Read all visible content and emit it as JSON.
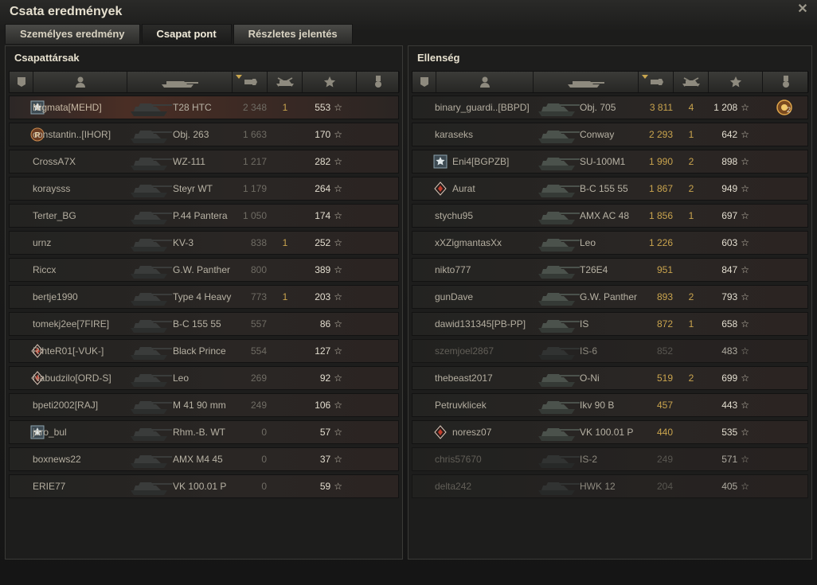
{
  "window": {
    "title": "Csata eredmények"
  },
  "tabs": [
    "Személyes eredmény",
    "Csapat pont",
    "Részletes jelentés"
  ],
  "active_tab": 1,
  "header_icons": [
    "platoon-icon",
    "player-icon",
    "tank-icon",
    "damage-icon",
    "kills-icon",
    "xp-star-icon",
    "medal-icon"
  ],
  "allies": {
    "title": "Csapattársak",
    "rows": [
      {
        "player": "Nigmata[MEHD]",
        "tank": "T28 HTC",
        "damage": "2 348",
        "kills": "1",
        "xp": "553",
        "badge": "star",
        "highlight": true
      },
      {
        "player": "constantin..[IHOR]",
        "tank": "Obj. 263",
        "damage": "1 663",
        "kills": "",
        "xp": "170",
        "badge": "rank"
      },
      {
        "player": "CrossA7X",
        "tank": "WZ-111",
        "damage": "1 217",
        "kills": "",
        "xp": "282"
      },
      {
        "player": "koraysss",
        "tank": "Steyr WT",
        "damage": "1 179",
        "kills": "",
        "xp": "264"
      },
      {
        "player": "Terter_BG",
        "tank": "P.44 Pantera",
        "damage": "1 050",
        "kills": "",
        "xp": "174"
      },
      {
        "player": "urnz",
        "tank": "KV-3",
        "damage": "838",
        "kills": "1",
        "xp": "252"
      },
      {
        "player": "Riccx",
        "tank": "G.W. Panther",
        "damage": "800",
        "kills": "",
        "xp": "389"
      },
      {
        "player": "bertje1990",
        "tank": "Type 4 Heavy",
        "damage": "773",
        "kills": "1",
        "xp": "203"
      },
      {
        "player": "tomekj2ee[7FIRE]",
        "tank": "B-C 155 55",
        "damage": "557",
        "kills": "",
        "xp": "86"
      },
      {
        "player": "RihteR01[-VUK-]",
        "tank": "Black Prince",
        "damage": "554",
        "kills": "",
        "xp": "127",
        "badge": "diamond"
      },
      {
        "player": "Nabudzilo[ORD-S]",
        "tank": "Leo",
        "damage": "269",
        "kills": "",
        "xp": "92",
        "badge": "diamond"
      },
      {
        "player": "bpeti2002[RAJ]",
        "tank": "M 41 90 mm",
        "damage": "249",
        "kills": "",
        "xp": "106"
      },
      {
        "player": "joro_bul",
        "tank": "Rhm.-B. WT",
        "damage": "0",
        "kills": "",
        "xp": "57",
        "badge": "star"
      },
      {
        "player": "boxnews22",
        "tank": "AMX M4 45",
        "damage": "0",
        "kills": "",
        "xp": "37"
      },
      {
        "player": "ERIE77",
        "tank": "VK 100.01 P",
        "damage": "0",
        "kills": "",
        "xp": "59"
      }
    ]
  },
  "enemies": {
    "title": "Ellenség",
    "rows": [
      {
        "player": "binary_guardi..[BBPD]",
        "tank": "Obj. 705",
        "damage": "3 811",
        "kills": "4",
        "xp": "1 208",
        "medal": "2",
        "alive": true
      },
      {
        "player": "karaseks",
        "tank": "Conway",
        "damage": "2 293",
        "kills": "1",
        "xp": "642",
        "alive": true
      },
      {
        "player": "Eni4[BGPZB]",
        "tank": "SU-100M1",
        "damage": "1 990",
        "kills": "2",
        "xp": "898",
        "badge": "star",
        "alive": true
      },
      {
        "player": "Aurat",
        "tank": "B-C 155 55",
        "damage": "1 867",
        "kills": "2",
        "xp": "949",
        "badge": "diamond",
        "alive": true
      },
      {
        "player": "stychu95",
        "tank": "AMX AC 48",
        "damage": "1 856",
        "kills": "1",
        "xp": "697",
        "alive": true
      },
      {
        "player": "xXZigmantasXx",
        "tank": "Leo",
        "damage": "1 226",
        "kills": "",
        "xp": "603",
        "alive": true
      },
      {
        "player": "nikto777",
        "tank": "T26E4",
        "damage": "951",
        "kills": "",
        "xp": "847",
        "alive": true
      },
      {
        "player": "gunDave",
        "tank": "G.W. Panther",
        "damage": "893",
        "kills": "2",
        "xp": "793",
        "alive": true
      },
      {
        "player": "dawid131345[PB-PP]",
        "tank": "IS",
        "damage": "872",
        "kills": "1",
        "xp": "658",
        "alive": true
      },
      {
        "player": "szemjoel2867",
        "tank": "IS-6",
        "damage": "852",
        "kills": "",
        "xp": "483",
        "alive": false
      },
      {
        "player": "thebeast2017",
        "tank": "O-Ni",
        "damage": "519",
        "kills": "2",
        "xp": "699",
        "alive": true
      },
      {
        "player": "Petruvklicek",
        "tank": "Ikv 90 B",
        "damage": "457",
        "kills": "",
        "xp": "443",
        "alive": true
      },
      {
        "player": "noresz07",
        "tank": "VK 100.01 P",
        "damage": "440",
        "kills": "",
        "xp": "535",
        "badge": "diamond",
        "alive": true
      },
      {
        "player": "chris57670",
        "tank": "IS-2",
        "damage": "249",
        "kills": "",
        "xp": "571",
        "alive": false
      },
      {
        "player": "delta242",
        "tank": "HWK 12",
        "damage": "204",
        "kills": "",
        "xp": "405",
        "alive": false
      }
    ]
  },
  "colors": {
    "gold": "#c9a44e",
    "text": "#b4aea0",
    "bright": "#e2ddcf",
    "dim": "#6f6c64"
  }
}
